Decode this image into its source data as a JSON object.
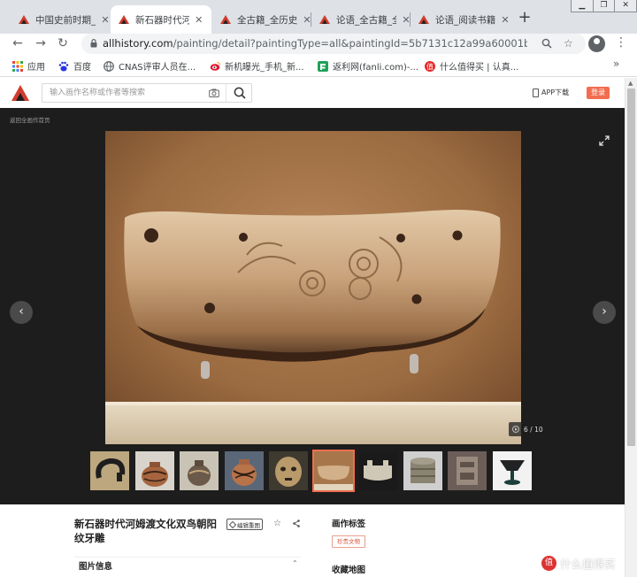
{
  "browser": {
    "tabs": [
      {
        "title": "中国史前时期_",
        "active": false
      },
      {
        "title": "新石器时代河姆",
        "active": true
      },
      {
        "title": "全古籍_全历史",
        "active": false
      },
      {
        "title": "论语_全古籍_全",
        "active": false
      },
      {
        "title": "论语_阅读书籍",
        "active": false
      }
    ],
    "new_tab": "+",
    "url_host": "allhistory.com",
    "url_path": "/painting/detail?paintingType=all&paintingId=5b7131c12a99a60001b5c0ec...",
    "bookmarks": [
      {
        "label": "应用",
        "icon": "apps-grid-icon"
      },
      {
        "label": "百度",
        "icon": "baidu-paw-icon"
      },
      {
        "label": "CNAS评审人员在...",
        "icon": "globe-icon"
      },
      {
        "label": "新机曝光_手机_新...",
        "icon": "weibo-eye-icon"
      },
      {
        "label": "返利网(fanli.com)-...",
        "icon": "fanli-icon"
      },
      {
        "label": "什么值得买 | 认真...",
        "icon": "smzdm-icon"
      }
    ]
  },
  "site": {
    "search_placeholder": "输入画作名称或作者等搜索",
    "app_download": "APP下载",
    "login": "登录"
  },
  "gallery": {
    "back_link": "返回全画作首页",
    "counter": "6 / 10",
    "prev": "‹",
    "next": "›",
    "current_index": 6,
    "total": 10,
    "thumbnail_count": 10
  },
  "work": {
    "title": "新石器时代河姆渡文化双鸟朝阳纹牙雕",
    "edit_label": "编辑重图",
    "picture_info": "图片信息",
    "tags_heading": "画作标签",
    "tag": "珍贵文物",
    "map_heading": "收藏地图"
  },
  "watermark": {
    "icon_char": "值",
    "text": "什么值得买"
  }
}
